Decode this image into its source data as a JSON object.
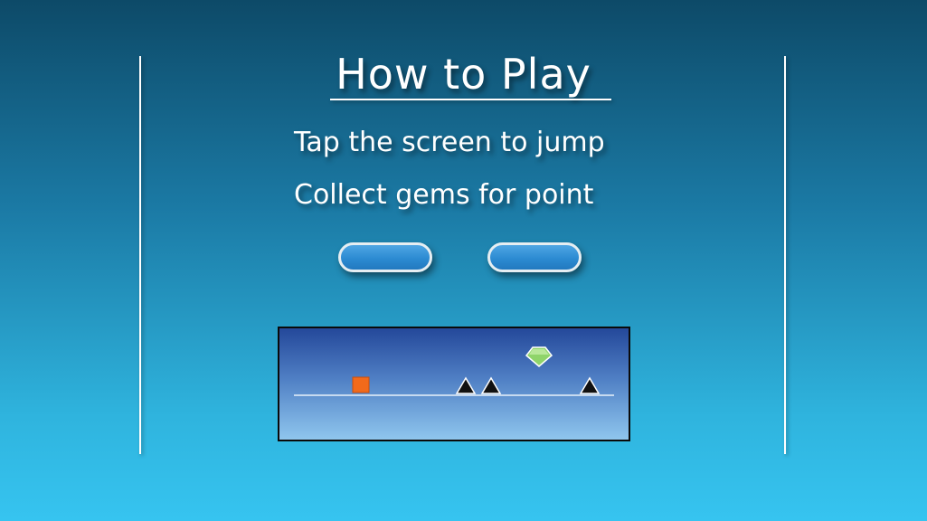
{
  "title": "How to Play",
  "instructions": [
    "Tap the screen to jump",
    "Collect gems for point"
  ],
  "buttons": [
    {
      "label": ""
    },
    {
      "label": ""
    }
  ],
  "preview": {
    "player_color": "#f26a1b",
    "gem_color": "#8fd46a",
    "spike_color": "#111111",
    "ground_color": "#e8f2fb"
  }
}
